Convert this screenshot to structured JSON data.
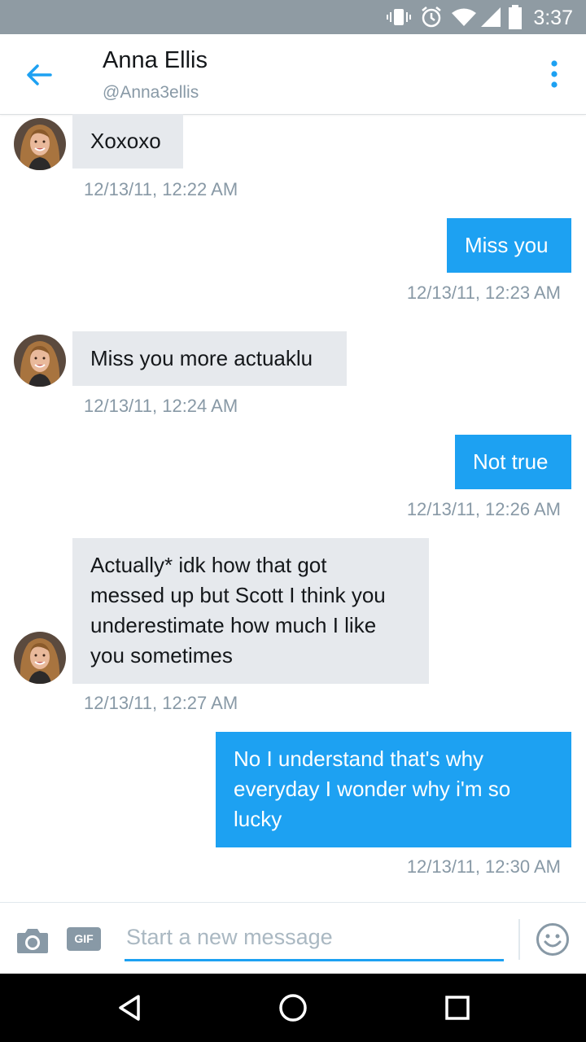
{
  "status_bar": {
    "time": "3:37"
  },
  "header": {
    "name": "Anna Ellis",
    "handle": "@Anna3ellis"
  },
  "messages": [
    {
      "direction": "incoming",
      "text": "Xoxoxo",
      "timestamp": "12/13/11, 12:22 AM"
    },
    {
      "direction": "outgoing",
      "text": "Miss you",
      "timestamp": "12/13/11, 12:23 AM"
    },
    {
      "direction": "incoming",
      "text": "Miss you more actuaklu",
      "timestamp": "12/13/11, 12:24 AM"
    },
    {
      "direction": "outgoing",
      "text": "Not true",
      "timestamp": "12/13/11, 12:26 AM"
    },
    {
      "direction": "incoming",
      "lines": [
        "Actually* idk how that got",
        "messed up but Scott I think you",
        "underestimate how much I like",
        "you sometimes"
      ],
      "timestamp": "12/13/11, 12:27 AM"
    },
    {
      "direction": "outgoing",
      "lines": [
        "No I understand that's why",
        "everyday I wonder why i'm so",
        "lucky"
      ],
      "timestamp": "12/13/11, 12:30 AM"
    }
  ],
  "composer": {
    "placeholder": "Start a new message",
    "gif_label": "GIF"
  },
  "colors": {
    "accent": "#1da1f2",
    "incoming_bubble": "#e6e9ed",
    "status_bar": "#8f9ba3"
  },
  "icons": [
    "vibrate-icon",
    "alarm-icon",
    "wifi-icon",
    "signal-icon",
    "battery-icon",
    "back-arrow-icon",
    "more-vertical-icon",
    "camera-icon",
    "gif-icon",
    "emoji-icon",
    "nav-back-icon",
    "nav-home-icon",
    "nav-recents-icon"
  ]
}
